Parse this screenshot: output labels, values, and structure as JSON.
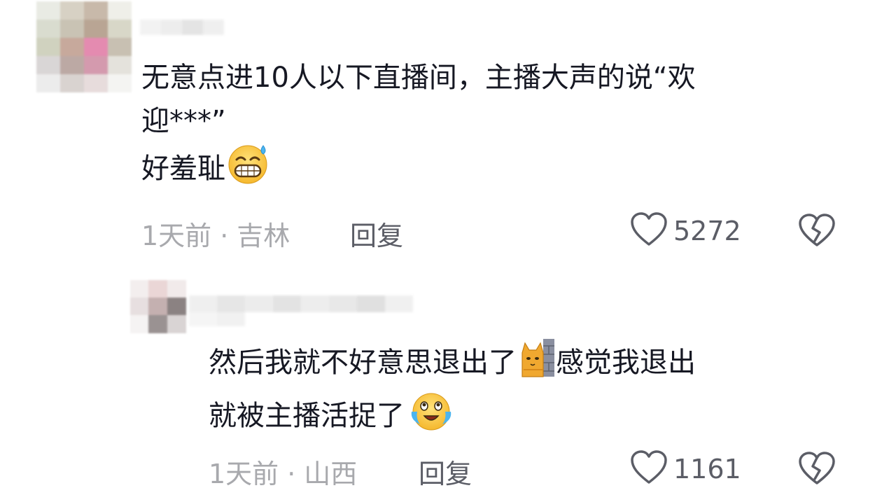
{
  "comments": [
    {
      "text_line1": "无意点进10人以下直播间，主播大声的说“欢",
      "text_line2": "迎***”",
      "text_line3": "好羞耻",
      "emoji": "grinning-sweat-emoji",
      "time": "1天前",
      "location": "吉林",
      "reply_label": "回复",
      "likes": "5272"
    },
    {
      "text_line1_a": "然后我就不好意思退出了",
      "text_line1_b": "感觉我退出",
      "text_line2": "就被主播活捉了",
      "emoji1": "cat-peeking-wall-emoji",
      "emoji2": "crying-laughing-emoji",
      "time": "1天前",
      "location": "山西",
      "reply_label": "回复",
      "likes": "1161"
    }
  ],
  "separator_dot": "·",
  "colors": {
    "text": "#161823",
    "meta": "#a8a9ad",
    "action": "#5b5d66"
  }
}
